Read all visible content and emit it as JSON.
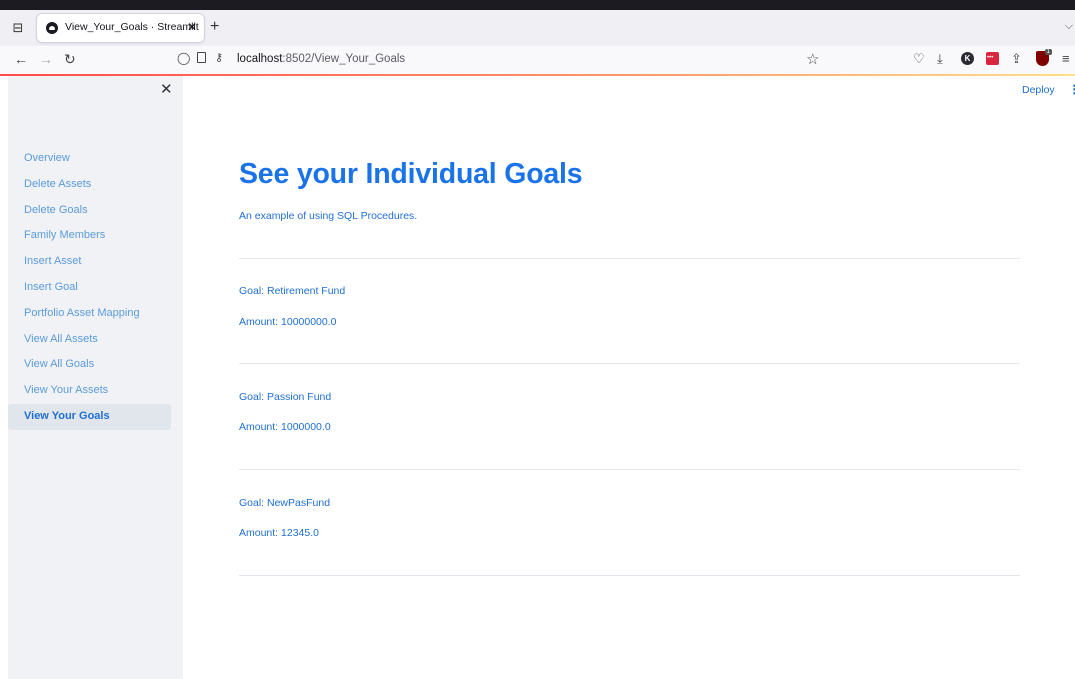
{
  "browser": {
    "tab_title": "View_Your_Goals · Streamlit",
    "url_host": "localhost",
    "url_path": ":8502/View_Your_Goals"
  },
  "sidebar": {
    "items": [
      {
        "label": "Overview",
        "active": false
      },
      {
        "label": "Delete Assets",
        "active": false
      },
      {
        "label": "Delete Goals",
        "active": false
      },
      {
        "label": "Family Members",
        "active": false
      },
      {
        "label": "Insert Asset",
        "active": false
      },
      {
        "label": "Insert Goal",
        "active": false
      },
      {
        "label": "Portfolio Asset Mapping",
        "active": false
      },
      {
        "label": "View All Assets",
        "active": false
      },
      {
        "label": "View All Goals",
        "active": false
      },
      {
        "label": "View Your Assets",
        "active": false
      },
      {
        "label": "View Your Goals",
        "active": true
      }
    ]
  },
  "header": {
    "deploy_label": "Deploy"
  },
  "main": {
    "title": "See your Individual Goals",
    "caption": "An example of using SQL Procedures.",
    "goals": [
      {
        "name": "Goal: Retirement Fund",
        "amount": "Amount: 10000000.0"
      },
      {
        "name": "Goal: Passion Fund",
        "amount": "Amount: 1000000.0"
      },
      {
        "name": "Goal: NewPasFund",
        "amount": "Amount: 12345.0"
      }
    ]
  },
  "colors": {
    "accent": "#1a73e8",
    "link": "#5b9bd9",
    "sidebar_bg": "#f0f2f6",
    "divider": "#e3e6ec"
  }
}
